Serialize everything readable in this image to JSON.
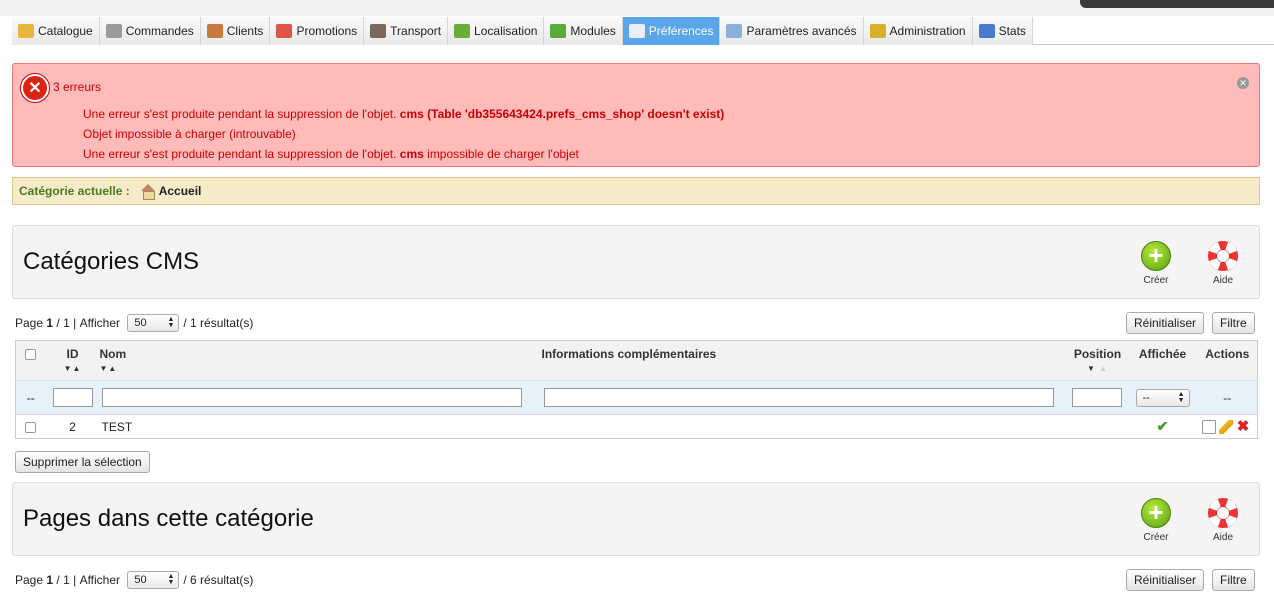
{
  "tabs": [
    {
      "label": "Catalogue",
      "icon": "folder-icon",
      "color": "#e8b63a"
    },
    {
      "label": "Commandes",
      "icon": "cart-icon",
      "color": "#9a9a9a"
    },
    {
      "label": "Clients",
      "icon": "user-icon",
      "color": "#c77a3c"
    },
    {
      "label": "Promotions",
      "icon": "gift-icon",
      "color": "#e0554a"
    },
    {
      "label": "Transport",
      "icon": "truck-icon",
      "color": "#7a6a5a"
    },
    {
      "label": "Localisation",
      "icon": "globe-icon",
      "color": "#6aae3a"
    },
    {
      "label": "Modules",
      "icon": "puzzle-icon",
      "color": "#5aaa3a"
    },
    {
      "label": "Préférences",
      "icon": "preferences-icon",
      "color": "#e9edf5",
      "active": true
    },
    {
      "label": "Paramètres avancés",
      "icon": "wrench-icon",
      "color": "#8ab0d8"
    },
    {
      "label": "Administration",
      "icon": "key-icon",
      "color": "#d9b02a"
    },
    {
      "label": "Stats",
      "icon": "chart-icon",
      "color": "#4a7ad0"
    }
  ],
  "errors": {
    "title": "3 erreurs",
    "items": [
      {
        "text": "Une erreur s'est produite pendant la suppression de l'objet. ",
        "bold": "cms (Table 'db355643424.prefs_cms_shop' doesn't exist)",
        "rest": ""
      },
      {
        "text": "Objet impossible à charger (introuvable)",
        "bold": "",
        "rest": ""
      },
      {
        "text": "Une erreur s'est produite pendant la suppression de l'objet. ",
        "bold": "cms",
        "rest": " impossible de charger l'objet"
      }
    ]
  },
  "breadcrumb": {
    "label": "Catégorie actuelle :",
    "home": "Accueil"
  },
  "panel1": {
    "title": "Catégories CMS",
    "create": "Créer",
    "help": "Aide"
  },
  "pager1": {
    "page_prefix": "Page",
    "page": "1",
    "pages": "1",
    "show_label": "Afficher",
    "per_page": "50",
    "results": "/ 1 résultat(s)"
  },
  "buttons": {
    "reset": "Réinitialiser",
    "filter": "Filtre",
    "delete_selection": "Supprimer la sélection"
  },
  "table": {
    "headers": {
      "id": "ID",
      "name": "Nom",
      "info": "Informations complémentaires",
      "position": "Position",
      "shown": "Affichée",
      "actions": "Actions"
    },
    "filter": {
      "dash": "--",
      "shown_select": "--",
      "actions_dash": "--"
    },
    "rows": [
      {
        "id": "2",
        "name": "TEST"
      }
    ]
  },
  "panel2": {
    "title": "Pages dans cette catégorie",
    "create": "Créer",
    "help": "Aide"
  },
  "pager2": {
    "page_prefix": "Page",
    "page": "1",
    "pages": "1",
    "show_label": "Afficher",
    "per_page": "50",
    "results": "/ 6 résultat(s)"
  }
}
